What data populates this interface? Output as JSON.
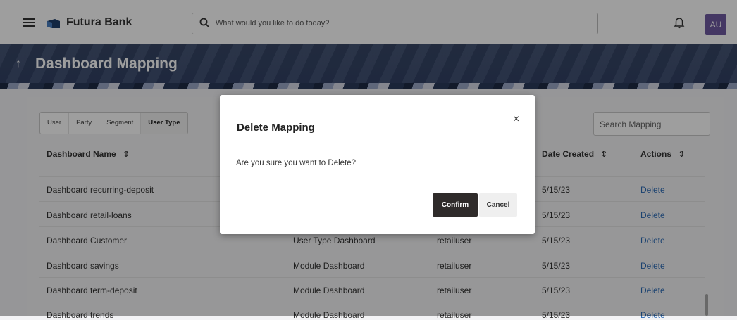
{
  "app": {
    "brand": "Futura Bank",
    "search_placeholder": "What would you like to do today?",
    "avatar_initials": "AU"
  },
  "page": {
    "title": "Dashboard Mapping",
    "back_icon": "↑"
  },
  "filters": {
    "tabs": [
      "User",
      "Party",
      "Segment",
      "User Type"
    ],
    "selected": "User Type",
    "search_placeholder": "Search Mapping"
  },
  "table": {
    "headers": {
      "name": "Dashboard Name",
      "date": "Date Created",
      "actions": "Actions",
      "sort_icon": "⇕"
    },
    "rows": [
      {
        "name": "Dashboard recurring-deposit",
        "type": "",
        "user": "",
        "date": "5/15/23",
        "action": "Delete"
      },
      {
        "name": "Dashboard retail-loans",
        "type": "",
        "user": "",
        "date": "5/15/23",
        "action": "Delete"
      },
      {
        "name": "Dashboard Customer",
        "type": "User Type Dashboard",
        "user": "retailuser",
        "date": "5/15/23",
        "action": "Delete"
      },
      {
        "name": "Dashboard savings",
        "type": "Module Dashboard",
        "user": "retailuser",
        "date": "5/15/23",
        "action": "Delete"
      },
      {
        "name": "Dashboard term-deposit",
        "type": "Module Dashboard",
        "user": "retailuser",
        "date": "5/15/23",
        "action": "Delete"
      },
      {
        "name": "Dashboard trends",
        "type": "Module Dashboard",
        "user": "retailuser",
        "date": "5/15/23",
        "action": "Delete"
      }
    ]
  },
  "modal": {
    "title": "Delete Mapping",
    "close": "×",
    "message": "Are you sure you want to Delete?",
    "confirm": "Confirm",
    "cancel": "Cancel"
  },
  "colors": {
    "accent": "#2d6bb5",
    "primary_button": "#2f2b2a",
    "header_band": "#3a4a6b",
    "avatar": "#6f5aa0"
  }
}
